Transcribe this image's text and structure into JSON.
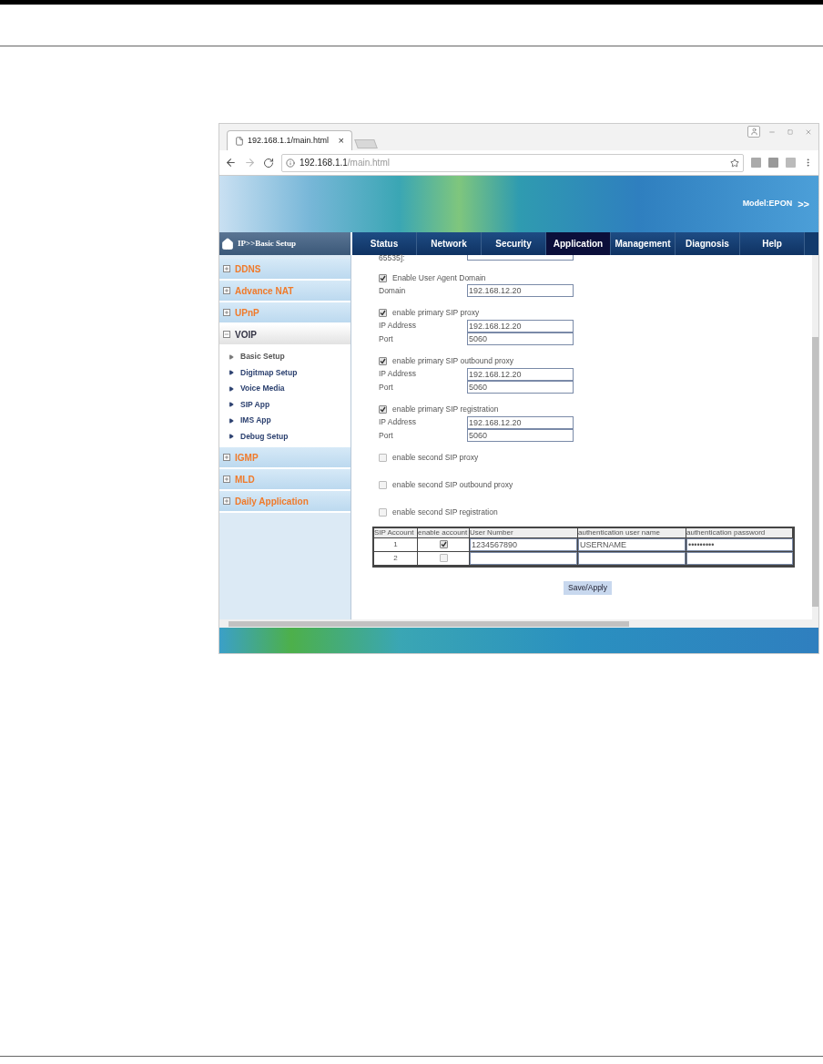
{
  "browser": {
    "tab_title": "192.168.1.1/main.html",
    "tab_close": "×",
    "url_host": "192.168.1.1",
    "url_path": "/main.html"
  },
  "banner": {
    "model": "Model:EPON",
    "more": ">>"
  },
  "breadcrumb": "IP>>Basic Setup",
  "nav_tabs": [
    {
      "label": "Status",
      "selected": false
    },
    {
      "label": "Network",
      "selected": false
    },
    {
      "label": "Security",
      "selected": false
    },
    {
      "label": "Application",
      "selected": true
    },
    {
      "label": "Management",
      "selected": false
    },
    {
      "label": "Diagnosis",
      "selected": false
    },
    {
      "label": "Help",
      "selected": false
    }
  ],
  "sidebar": {
    "items": [
      {
        "label": "DDNS",
        "expanded": false
      },
      {
        "label": "Advance NAT",
        "expanded": false
      },
      {
        "label": "UPnP",
        "expanded": false
      },
      {
        "label": "VOIP",
        "expanded": true,
        "children": [
          {
            "label": "Basic Setup",
            "selected": true
          },
          {
            "label": "Digitmap Setup",
            "selected": false
          },
          {
            "label": "Voice Media",
            "selected": false
          },
          {
            "label": "SIP App",
            "selected": false
          },
          {
            "label": "IMS App",
            "selected": false
          },
          {
            "label": "Debug Setup",
            "selected": false
          }
        ]
      },
      {
        "label": "IGMP",
        "expanded": false
      },
      {
        "label": "MLD",
        "expanded": false
      },
      {
        "label": "Daily Application",
        "expanded": false
      }
    ]
  },
  "form": {
    "cut_label": "65535]:",
    "sections": [
      {
        "label": "Enable User Agent Domain",
        "checked": true,
        "fields": [
          {
            "label": "Domain",
            "value": "192.168.12.20"
          }
        ]
      },
      {
        "label": "enable primary SIP proxy",
        "checked": true,
        "fields": [
          {
            "label": "IP Address",
            "value": "192.168.12.20"
          },
          {
            "label": "Port",
            "value": "5060"
          }
        ]
      },
      {
        "label": "enable primary SIP outbound proxy",
        "checked": true,
        "fields": [
          {
            "label": "IP Address",
            "value": "192.168.12.20"
          },
          {
            "label": "Port",
            "value": "5060"
          }
        ]
      },
      {
        "label": "enable primary SIP registration",
        "checked": true,
        "fields": [
          {
            "label": "IP Address",
            "value": "192.168.12.20"
          },
          {
            "label": "Port",
            "value": "5060"
          }
        ]
      },
      {
        "label": "enable second SIP proxy",
        "checked": false
      },
      {
        "label": "enable second SIP outbound proxy",
        "checked": false
      },
      {
        "label": "enable second SIP registration",
        "checked": false
      }
    ]
  },
  "accounts_table": {
    "columns": [
      "SIP Account",
      "enable account",
      "User Number",
      "authentication user name",
      "authentication password"
    ],
    "rows": [
      {
        "number": "1",
        "enabled": true,
        "user_number": "1234567890",
        "auth_user": "USERNAME",
        "auth_password": "•••••••••"
      },
      {
        "number": "2",
        "enabled": false
      }
    ]
  },
  "save_button": "Save/Apply"
}
